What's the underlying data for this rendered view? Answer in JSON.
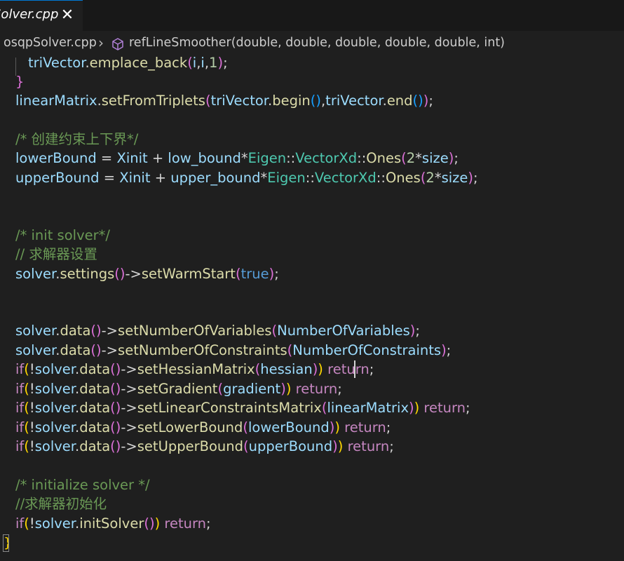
{
  "tab": {
    "title": "Solver.cpp",
    "close": "✕"
  },
  "breadcrumb": {
    "file": "osqpSolver.cpp",
    "separator": "›",
    "symbol": "refLineSmoother(double, double, double, double, double, int)"
  },
  "code": {
    "l1": {
      "a": "triVector",
      "b": ".",
      "c": "emplace_back",
      "d": "(",
      "e": "i",
      "f": ",",
      "g": "i",
      "h": ",",
      "i": "1",
      "j": ")",
      "k": ";"
    },
    "l2": {
      "a": "}"
    },
    "l3": {
      "a": "linearMatrix",
      "b": ".",
      "c": "setFromTriplets",
      "d": "(",
      "e": "triVector",
      "f": ".",
      "g": "begin",
      "h": "()",
      "i": ",",
      "j": "triVector",
      "k": ".",
      "l": "end",
      "m": "()",
      "n": ")",
      "o": ";"
    },
    "l4": {
      "a": "/* 创建约束上下界*/"
    },
    "l5": {
      "a": "lowerBound",
      "b": " = ",
      "c": "Xinit",
      "d": " + ",
      "e": "low_bound",
      "f": "*",
      "g": "Eigen",
      "h": "::",
      "i": "VectorXd",
      "j": "::",
      "k": "Ones",
      "l": "(",
      "m": "2",
      "n": "*",
      "o": "size",
      "p": ")",
      "q": ";"
    },
    "l6": {
      "a": "upperBound",
      "b": " = ",
      "c": "Xinit",
      "d": " + ",
      "e": "upper_bound",
      "f": "*",
      "g": "Eigen",
      "h": "::",
      "i": "VectorXd",
      "j": "::",
      "k": "Ones",
      "l": "(",
      "m": "2",
      "n": "*",
      "o": "size",
      "p": ")",
      "q": ";"
    },
    "l7": {
      "a": "/* init solver*/"
    },
    "l8": {
      "a": "// 求解器设置"
    },
    "l9": {
      "a": "solver",
      "b": ".",
      "c": "settings",
      "d": "()",
      "e": "->",
      "f": "setWarmStart",
      "g": "(",
      "h": "true",
      "i": ")",
      "j": ";"
    },
    "l10": {
      "a": "solver",
      "b": ".",
      "c": "data",
      "d": "()",
      "e": "->",
      "f": "setNumberOfVariables",
      "g": "(",
      "h": "NumberOfVariables",
      "i": ")",
      "j": ";"
    },
    "l11": {
      "a": "solver",
      "b": ".",
      "c": "data",
      "d": "()",
      "e": "->",
      "f": "setNumberOfConstraints",
      "g": "(",
      "h": "NumberOfConstraints",
      "i": ")",
      "j": ";"
    },
    "l12": {
      "a": "if",
      "b": "(",
      "c": "!",
      "d": "solver",
      "e": ".",
      "f": "data",
      "g": "()",
      "h": "->",
      "i": "setHessianMatrix",
      "j": "(",
      "k": "hessian",
      "l": ")",
      "m": ")",
      "n": " return",
      "o": ";"
    },
    "l13": {
      "a": "if",
      "b": "(",
      "c": "!",
      "d": "solver",
      "e": ".",
      "f": "data",
      "g": "()",
      "h": "->",
      "i": "setGradient",
      "j": "(",
      "k": "gradient",
      "l": ")",
      "m": ")",
      "n": " return",
      "o": ";"
    },
    "l14": {
      "a": "if",
      "b": "(",
      "c": "!",
      "d": "solver",
      "e": ".",
      "f": "data",
      "g": "()",
      "h": "->",
      "i": "setLinearConstraintsMatrix",
      "j": "(",
      "k": "linearMatrix",
      "l": ")",
      "m": ")",
      "n": " return",
      "o": ";"
    },
    "l15": {
      "a": "if",
      "b": "(",
      "c": "!",
      "d": "solver",
      "e": ".",
      "f": "data",
      "g": "()",
      "h": "->",
      "i": "setLowerBound",
      "j": "(",
      "k": "lowerBound",
      "l": ")",
      "m": ")",
      "n": " return",
      "o": ";"
    },
    "l16": {
      "a": "if",
      "b": "(",
      "c": "!",
      "d": "solver",
      "e": ".",
      "f": "data",
      "g": "()",
      "h": "->",
      "i": "setUpperBound",
      "j": "(",
      "k": "upperBound",
      "l": ")",
      "m": ")",
      "n": " return",
      "o": ";"
    },
    "l17": {
      "a": "/* initialize solver */"
    },
    "l18": {
      "a": "//求解器初始化"
    },
    "l19": {
      "a": "if",
      "b": "(",
      "c": "!",
      "d": "solver",
      "e": ".",
      "f": "initSolver",
      "g": "()",
      "h": ")",
      "i": " return",
      "j": ";"
    },
    "l20": {
      "a": "}"
    }
  },
  "colors": {
    "background": "#1f1f1f",
    "tab_accent": "#0078d4",
    "variable": "#9cdcfe",
    "function": "#dcdcaa",
    "type": "#4ec9b0",
    "keyword": "#c586c0",
    "comment": "#6a9955"
  }
}
